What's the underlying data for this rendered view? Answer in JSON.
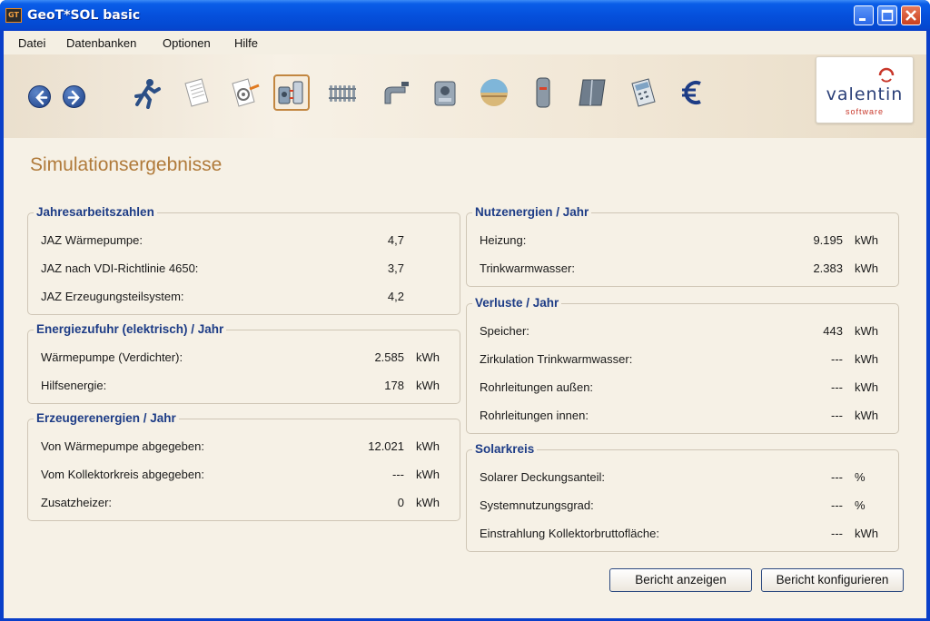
{
  "window": {
    "title": "GeoT*SOL basic",
    "app_icon_text": "GT"
  },
  "menu": [
    "Datei",
    "Datenbanken",
    "Optionen",
    "Hilfe"
  ],
  "toolbar": {
    "tools": [
      "back-icon",
      "forward-icon",
      "runner-icon",
      "document-icon",
      "document-settings-icon",
      "system-schematic-icon",
      "radiator-icon",
      "tap-icon",
      "heat-pump-icon",
      "ground-layer-icon",
      "storage-tank-icon",
      "collector-icon",
      "calculator-icon",
      "euro-icon"
    ],
    "active_tool": "system-schematic-icon"
  },
  "logo": {
    "name": "valentin",
    "sub": "software"
  },
  "page_title": "Simulationsergebnisse",
  "groups": {
    "jaz": {
      "title": "Jahresarbeitszahlen",
      "rows": [
        {
          "label": "JAZ Wärmepumpe:",
          "value": "4,7",
          "unit": ""
        },
        {
          "label": "JAZ nach VDI-Richtlinie 4650:",
          "value": "3,7",
          "unit": ""
        },
        {
          "label": "JAZ Erzeugungsteilsystem:",
          "value": "4,2",
          "unit": ""
        }
      ]
    },
    "energiezufuhr": {
      "title": "Energiezufuhr (elektrisch) / Jahr",
      "rows": [
        {
          "label": "Wärmepumpe (Verdichter):",
          "value": "2.585",
          "unit": "kWh"
        },
        {
          "label": "Hilfsenergie:",
          "value": "178",
          "unit": "kWh"
        }
      ]
    },
    "erzeuger": {
      "title": "Erzeugerenergien / Jahr",
      "rows": [
        {
          "label": "Von Wärmepumpe abgegeben:",
          "value": "12.021",
          "unit": "kWh"
        },
        {
          "label": "Vom Kollektorkreis abgegeben:",
          "value": "---",
          "unit": "kWh"
        },
        {
          "label": "Zusatzheizer:",
          "value": "0",
          "unit": "kWh"
        }
      ]
    },
    "nutzenergien": {
      "title": "Nutzenergien / Jahr",
      "rows": [
        {
          "label": "Heizung:",
          "value": "9.195",
          "unit": "kWh"
        },
        {
          "label": "Trinkwarmwasser:",
          "value": "2.383",
          "unit": "kWh"
        }
      ]
    },
    "verluste": {
      "title": "Verluste / Jahr",
      "rows": [
        {
          "label": "Speicher:",
          "value": "443",
          "unit": "kWh"
        },
        {
          "label": "Zirkulation Trinkwarmwasser:",
          "value": "---",
          "unit": "kWh"
        },
        {
          "label": "Rohrleitungen außen:",
          "value": "---",
          "unit": "kWh"
        },
        {
          "label": "Rohrleitungen innen:",
          "value": "---",
          "unit": "kWh"
        }
      ]
    },
    "solarkreis": {
      "title": "Solarkreis",
      "rows": [
        {
          "label": "Solarer Deckungsanteil:",
          "value": "---",
          "unit": "%"
        },
        {
          "label": "Systemnutzungsgrad:",
          "value": "---",
          "unit": "%"
        },
        {
          "label": "Einstrahlung Kollektorbruttofläche:",
          "value": "---",
          "unit": "kWh"
        }
      ]
    }
  },
  "buttons": {
    "show_report": "Bericht anzeigen",
    "configure_report": "Bericht konfigurieren"
  }
}
